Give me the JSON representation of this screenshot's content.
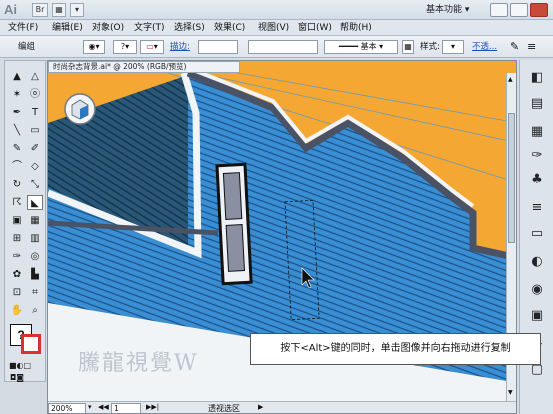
{
  "app": {
    "logo": "Ai",
    "br_label": "Br",
    "workspace": "基本功能",
    "colors": {
      "accent": "#2b78c2",
      "background": "#f4a733",
      "wall": "#3b8ed2"
    }
  },
  "menu": [
    "文件(F)",
    "编辑(E)",
    "对象(O)",
    "文字(T)",
    "选择(S)",
    "效果(C)",
    "视图(V)",
    "窗口(W)",
    "帮助(H)"
  ],
  "control": {
    "group_label": "编组",
    "stroke_link": "描边:",
    "stroke_value": "",
    "style_label": "基本",
    "style2_label": "样式:",
    "opacity_link": "不透..."
  },
  "document": {
    "tab": "时尚杂志背景.ai* @ 200% (RGB/预览)",
    "zoom": "200%",
    "page": "1",
    "status": "透视选区"
  },
  "overlay": {
    "instruction": "按下<Alt>键的同时，单击图像并向右拖动进行复制",
    "watermark": "騰龍視覺W"
  }
}
